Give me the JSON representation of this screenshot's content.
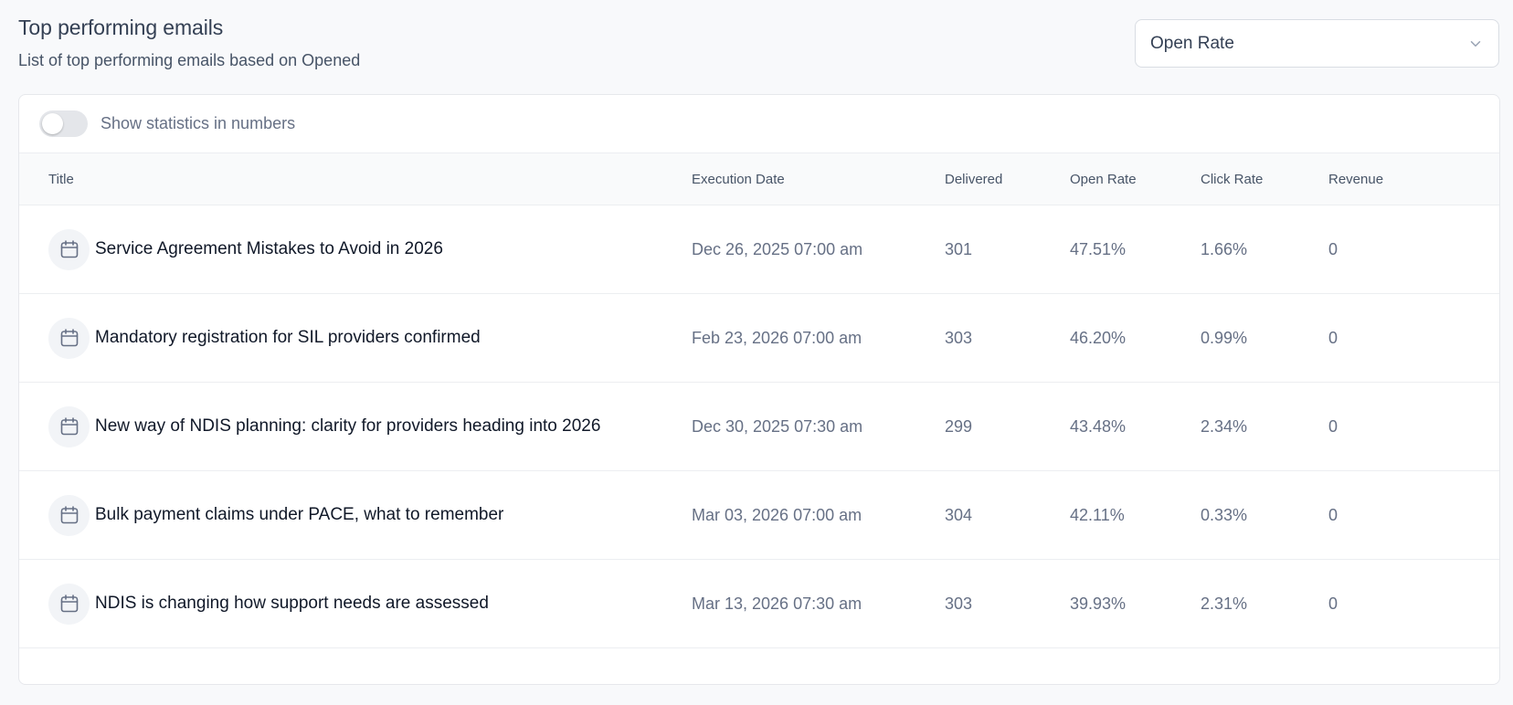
{
  "header": {
    "title": "Top performing emails",
    "subtitle": "List of top performing emails based on Opened"
  },
  "metric_select": {
    "value": "Open Rate",
    "icon": "chevron-down-icon"
  },
  "stats_toggle": {
    "label": "Show statistics in numbers",
    "checked": false
  },
  "table": {
    "columns": {
      "title": "Title",
      "date": "Execution Date",
      "delivered": "Delivered",
      "open_rate": "Open Rate",
      "click_rate": "Click Rate",
      "revenue": "Revenue"
    },
    "row_icon": "calendar-icon",
    "rows": [
      {
        "title": "Service Agreement Mistakes to Avoid in 2026",
        "date": "Dec 26, 2025 07:00 am",
        "delivered": "301",
        "open_rate": "47.51%",
        "click_rate": "1.66%",
        "revenue": "0"
      },
      {
        "title": "Mandatory registration for SIL providers confirmed",
        "date": "Feb 23, 2026 07:00 am",
        "delivered": "303",
        "open_rate": "46.20%",
        "click_rate": "0.99%",
        "revenue": "0"
      },
      {
        "title": "New way of NDIS planning: clarity for providers heading into 2026",
        "date": "Dec 30, 2025 07:30 am",
        "delivered": "299",
        "open_rate": "43.48%",
        "click_rate": "2.34%",
        "revenue": "0"
      },
      {
        "title": "Bulk payment claims under PACE, what to remember",
        "date": "Mar 03, 2026 07:00 am",
        "delivered": "304",
        "open_rate": "42.11%",
        "click_rate": "0.33%",
        "revenue": "0"
      },
      {
        "title": "NDIS is changing how support needs are assessed",
        "date": "Mar 13, 2026 07:30 am",
        "delivered": "303",
        "open_rate": "39.93%",
        "click_rate": "2.31%",
        "revenue": "0"
      }
    ]
  }
}
